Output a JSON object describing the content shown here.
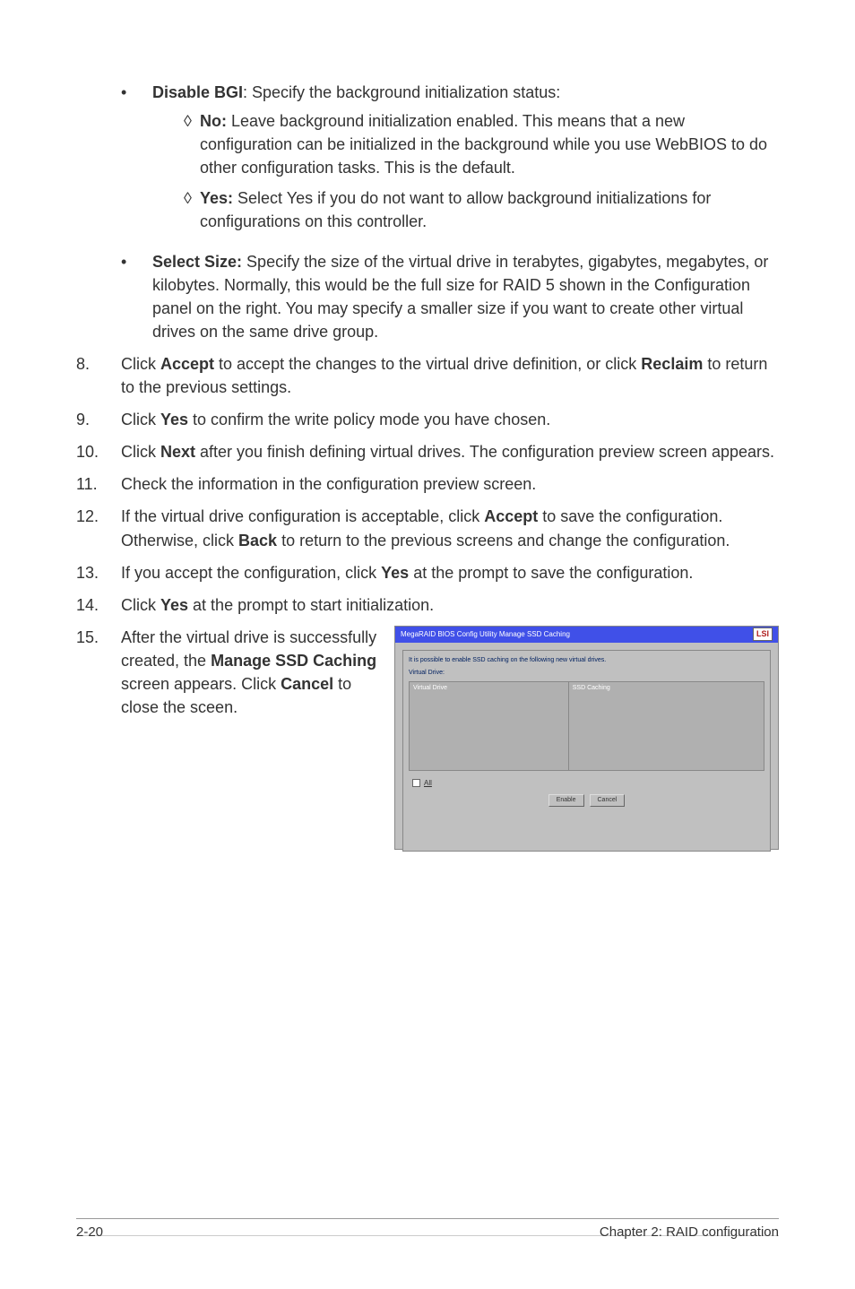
{
  "bullets": {
    "disable_bgi": {
      "label": "Disable BGI",
      "text": ": Specify the background initialization status:",
      "no_label": "No:",
      "no_text": " Leave background initialization enabled. This means that a new configuration can be initialized in the background while you use WebBIOS to do other configuration tasks. This is the default.",
      "yes_label": "Yes:",
      "yes_text": " Select Yes if you do not want to allow background initializations for configurations on this controller."
    },
    "select_size": {
      "label": "Select Size:",
      "text": " Specify the size of the virtual drive in terabytes, gigabytes, megabytes, or kilobytes. Normally, this would be the full size for RAID 5 shown in the Configuration panel on the right. You may specify a smaller size if you want to create other virtual drives on the same drive group."
    }
  },
  "steps": {
    "8": {
      "num": "8.",
      "p1": "Click ",
      "accept": "Accept",
      "p2": " to accept the changes to the virtual drive definition, or click ",
      "reclaim": "Reclaim",
      "p3": " to return to the previous settings."
    },
    "9": {
      "num": "9.",
      "p1": "Click ",
      "yes": "Yes",
      "p2": " to confirm the write policy mode you have chosen."
    },
    "10": {
      "num": "10.",
      "p1": "Click ",
      "next": "Next",
      "p2": " after you finish defining virtual drives. The configuration preview screen appears."
    },
    "11": {
      "num": "11.",
      "text": "Check the information in the configuration preview screen."
    },
    "12": {
      "num": "12.",
      "p1": "If the virtual drive configuration is acceptable, click ",
      "accept": "Accept",
      "p2": " to save the configuration. Otherwise, click ",
      "back": "Back",
      "p3": " to return to the previous screens and change the configuration."
    },
    "13": {
      "num": "13.",
      "p1": "If you accept the configuration, click ",
      "yes": "Yes",
      "p2": " at the prompt to save the configuration."
    },
    "14": {
      "num": "14.",
      "p1": "Click ",
      "yes": "Yes",
      "p2": " at the prompt to start initialization."
    },
    "15": {
      "num": "15.",
      "p1": "After the virtual drive is successfully created, the ",
      "manage": "Manage SSD Caching",
      "p2": " screen appears. Click ",
      "cancel": "Cancel",
      "p3": " to close the sceen."
    }
  },
  "dialog": {
    "title": "MegaRAID BIOS Config Utility Manage SSD Caching",
    "logo": "LSI",
    "message": "It is possible to enable SSD caching on the following new virtual drives.",
    "vd_label": "Virtual Drive:",
    "col1": "Virtual Drive",
    "col2": "SSD Caching",
    "all": "All",
    "enable": "Enable",
    "cancel_btn": "Cancel"
  },
  "footer": {
    "left": "2-20",
    "right": "Chapter 2: RAID configuration"
  }
}
